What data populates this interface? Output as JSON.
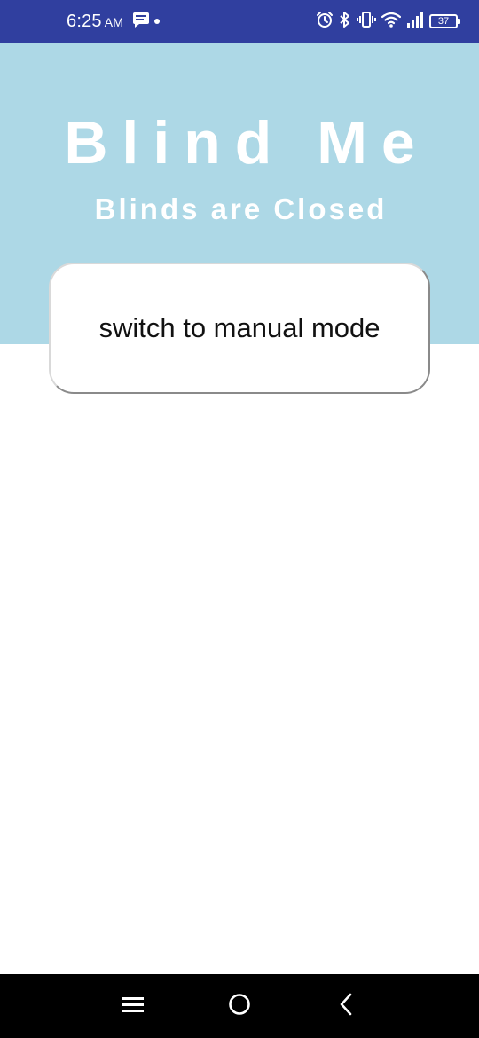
{
  "status_bar": {
    "time": "6:25",
    "ampm": "AM",
    "battery_level": "37",
    "left_icons": [
      "message-icon",
      "dot-indicator"
    ],
    "right_icons": [
      "alarm-icon",
      "bluetooth-icon",
      "vibrate-icon",
      "wifi-icon",
      "signal-icon",
      "battery-icon"
    ],
    "background": "#303f9f"
  },
  "header": {
    "title": "Blind Me",
    "status": "Blinds are Closed",
    "background": "#add8e6"
  },
  "mode_button": {
    "label": "switch to manual mode"
  },
  "nav_bar": {
    "buttons": [
      "menu-icon",
      "home-icon",
      "back-icon"
    ],
    "background": "#000000"
  }
}
